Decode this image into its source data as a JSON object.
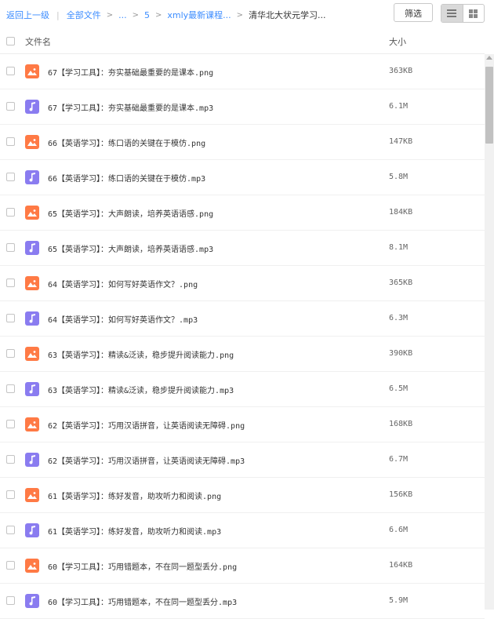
{
  "breadcrumb": {
    "back": "返回上一级",
    "all_files": "全部文件",
    "ellipsis": "...",
    "folder_5": "5",
    "folder_course": "xmly最新课程...",
    "current": "清华北大状元学习..."
  },
  "toolbar": {
    "filter_label": "筛选"
  },
  "table": {
    "col_name": "文件名",
    "col_size": "大小"
  },
  "files": [
    {
      "name": "67【学习工具】：夯实基础最重要的是课本.png",
      "size": "363KB",
      "type": "png"
    },
    {
      "name": "67【学习工具】：夯实基础最重要的是课本.mp3",
      "size": "6.1M",
      "type": "mp3"
    },
    {
      "name": "66【英语学习】：练口语的关键在于模仿.png",
      "size": "147KB",
      "type": "png"
    },
    {
      "name": "66【英语学习】：练口语的关键在于模仿.mp3",
      "size": "5.8M",
      "type": "mp3"
    },
    {
      "name": "65【英语学习】：大声朗读，培养英语语感.png",
      "size": "184KB",
      "type": "png"
    },
    {
      "name": "65【英语学习】：大声朗读，培养英语语感.mp3",
      "size": "8.1M",
      "type": "mp3"
    },
    {
      "name": "64【英语学习】：如何写好英语作文？.png",
      "size": "365KB",
      "type": "png"
    },
    {
      "name": "64【英语学习】：如何写好英语作文？.mp3",
      "size": "6.3M",
      "type": "mp3"
    },
    {
      "name": "63【英语学习】：精读&泛读，稳步提升阅读能力.png",
      "size": "390KB",
      "type": "png"
    },
    {
      "name": "63【英语学习】：精读&泛读，稳步提升阅读能力.mp3",
      "size": "6.5M",
      "type": "mp3"
    },
    {
      "name": "62【英语学习】：巧用汉语拼音，让英语阅读无障碍.png",
      "size": "168KB",
      "type": "png"
    },
    {
      "name": "62【英语学习】：巧用汉语拼音，让英语阅读无障碍.mp3",
      "size": "6.7M",
      "type": "mp3"
    },
    {
      "name": "61【英语学习】：练好发音，助攻听力和阅读.png",
      "size": "156KB",
      "type": "png"
    },
    {
      "name": "61【英语学习】：练好发音，助攻听力和阅读.mp3",
      "size": "6.6M",
      "type": "mp3"
    },
    {
      "name": "60【学习工具】：巧用错题本，不在同一题型丢分.png",
      "size": "164KB",
      "type": "png"
    },
    {
      "name": "60【学习工具】：巧用错题本，不在同一题型丢分.mp3",
      "size": "5.9M",
      "type": "mp3"
    }
  ],
  "colors": {
    "png_icon": "#ff7a45",
    "mp3_icon": "#8a7cf0",
    "link": "#3b8cff"
  },
  "icons": {
    "png": "image-file-icon",
    "mp3": "audio-file-icon"
  }
}
